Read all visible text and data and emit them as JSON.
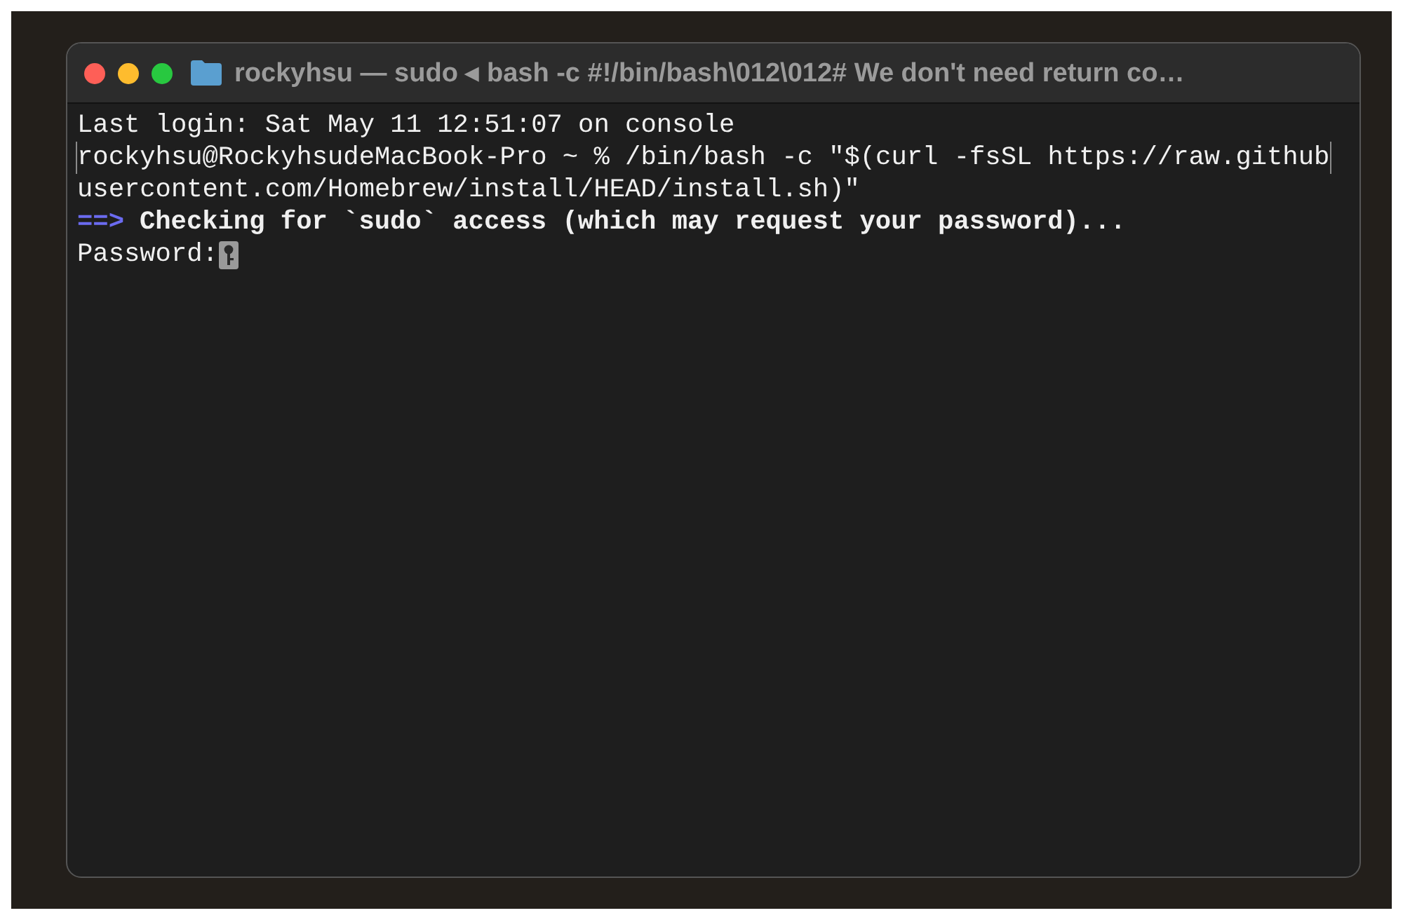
{
  "window": {
    "title": "rockyhsu — sudo ◂ bash -c #!/bin/bash\\012\\012# We don't need return co…"
  },
  "lines": [
    {
      "kind": "text",
      "text": "Last login: Sat May 11 12:51:07 on console",
      "marked": false
    },
    {
      "kind": "text",
      "text": "rockyhsu@RockyhsudeMacBook-Pro ~ % /bin/bash -c \"$(curl -fsSL https://raw.github",
      "marked": true
    },
    {
      "kind": "text",
      "text": "usercontent.com/Homebrew/install/HEAD/install.sh)\"",
      "marked": false
    },
    {
      "kind": "heading",
      "arrow": "==>",
      "text": "Checking for `sudo` access (which may request your password)...",
      "marked": false
    },
    {
      "kind": "prompt",
      "text": "Password:",
      "marked": false
    }
  ]
}
